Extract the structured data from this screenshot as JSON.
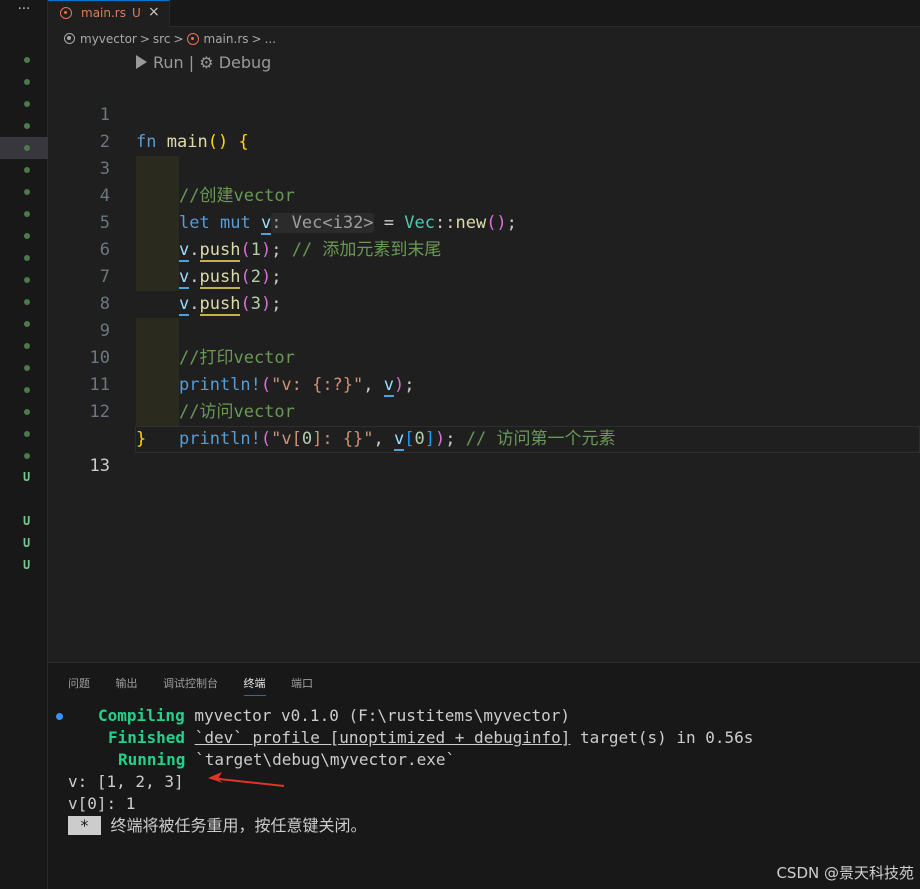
{
  "sidebar": {
    "menu_glyph": "···",
    "markers": [
      "dot",
      "dot",
      "dot",
      "dot",
      "dot",
      "dot",
      "dot",
      "dot",
      "dot",
      "dot",
      "dot",
      "dot",
      "dot",
      "dot",
      "dot",
      "dot",
      "dot",
      "dot",
      "dot",
      "U",
      "",
      "U",
      "U",
      "U"
    ],
    "selected_index": 4
  },
  "tab": {
    "name": "main.rs",
    "status": "U",
    "close": "×",
    "icon": "rust-icon"
  },
  "breadcrumb": {
    "project": "myvector",
    "folder": "src",
    "file": "main.rs",
    "more": "...",
    "separator": ">"
  },
  "codelens": {
    "run": "Run",
    "divider": "|",
    "debug": "Debug",
    "debug_glyph": "⚙"
  },
  "editor": {
    "line_numbers": [
      "1",
      "2",
      "3",
      "4",
      "5",
      "6",
      "7",
      "8",
      "9",
      "10",
      "11",
      "12",
      "13"
    ],
    "active_line": "13",
    "tokens": {
      "l1": {
        "fn": "fn",
        "name": "main",
        "open": "(",
        "close": ")",
        "brace": "{"
      },
      "l2": {
        "comment": "//创建vector"
      },
      "l3": {
        "let": "let",
        "mut": "mut",
        "v": "v",
        "hint": ": Vec<i32>",
        "eq": " = ",
        "vec": "Vec",
        "colons": "::",
        "new": "new",
        "paren": "()",
        "semi": ";"
      },
      "l4": {
        "v": "v",
        "dot": ".",
        "push": "push",
        "open": "(",
        "n": "1",
        "close": ")",
        "semi": "; ",
        "comment": "// 添加元素到末尾"
      },
      "l5": {
        "v": "v",
        "dot": ".",
        "push": "push",
        "open": "(",
        "n": "2",
        "close": ")",
        "semi": ";"
      },
      "l6": {
        "v": "v",
        "dot": ".",
        "push": "push",
        "open": "(",
        "n": "3",
        "close": ")",
        "semi": ";"
      },
      "l8": {
        "comment": "//打印vector"
      },
      "l9": {
        "mac": "println!",
        "open": "(",
        "str": "\"v: {:?}\"",
        "comma": ", ",
        "v": "v",
        "close": ")",
        "semi": ";"
      },
      "l10": {
        "comment": "//访问vector"
      },
      "l11": {
        "mac": "println!",
        "open": "(",
        "str1": "\"v[",
        "n": "0",
        "str2": "]: {}\"",
        "comma": ", ",
        "v": "v",
        "br_open": "[",
        "idx": "0",
        "br_close": "]",
        "close": ")",
        "semi": "; ",
        "comment": "// 访问第一个元素"
      },
      "l12": {
        "brace": "}"
      }
    }
  },
  "panel": {
    "tabs": [
      "问题",
      "输出",
      "调试控制台",
      "终端",
      "端口"
    ],
    "active_tab": "终端",
    "terminal": {
      "compiling_label": "Compiling",
      "compiling_text": " myvector v0.1.0 (F:\\rustitems\\myvector)",
      "finished_label": "Finished",
      "finished_pre": " ",
      "finished_underlined": "`dev` profile [unoptimized + debuginfo]",
      "finished_post": " target(s) in 0.56s",
      "running_label": "Running",
      "running_text": " `target\\debug\\myvector.exe`",
      "output1": "v: [1, 2, 3]",
      "output2": "v[0]: 1",
      "reuse_marker": " * ",
      "reuse_text": " 终端将被任务重用，按任意键关闭。"
    }
  },
  "annotation": {
    "arrow_color": "#e0342b"
  },
  "watermark": "CSDN @景天科技苑"
}
